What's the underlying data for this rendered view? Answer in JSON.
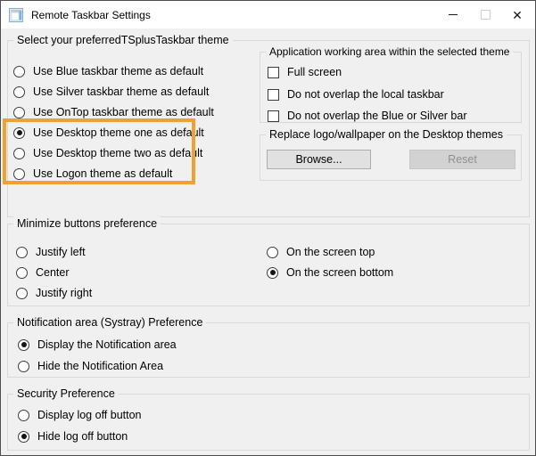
{
  "window": {
    "title": "Remote Taskbar Settings",
    "close_glyph": "✕"
  },
  "theme_group": {
    "label": "Select your preferredTSplusTaskbar theme",
    "options": [
      {
        "label": "Use Blue taskbar theme as default",
        "selected": false,
        "highlighted": false
      },
      {
        "label": "Use Silver taskbar theme as default",
        "selected": false,
        "highlighted": false
      },
      {
        "label": "Use OnTop taskbar theme as default",
        "selected": false,
        "highlighted": false
      },
      {
        "label": "Use Desktop theme one as default",
        "selected": true,
        "highlighted": true
      },
      {
        "label": "Use Desktop theme two as default",
        "selected": false,
        "highlighted": true
      },
      {
        "label": "Use Logon theme as default",
        "selected": false,
        "highlighted": true
      }
    ]
  },
  "working_area_group": {
    "label": "Application working area within the selected theme",
    "options": [
      {
        "label": "Full screen",
        "checked": false
      },
      {
        "label": "Do not overlap the local taskbar",
        "checked": false
      },
      {
        "label": "Do not overlap the Blue or Silver bar",
        "checked": false
      }
    ]
  },
  "replace_group": {
    "label": "Replace logo/wallpaper on the Desktop themes",
    "browse_label": "Browse...",
    "reset_label": "Reset",
    "reset_enabled": false
  },
  "minimize_group": {
    "label": "Minimize buttons preference",
    "left_options": [
      {
        "label": "Justify left",
        "selected": false
      },
      {
        "label": "Center",
        "selected": false
      },
      {
        "label": "Justify right",
        "selected": false
      }
    ],
    "right_options": [
      {
        "label": "On the screen top",
        "selected": false
      },
      {
        "label": "On the screen bottom",
        "selected": true
      }
    ]
  },
  "notification_group": {
    "label": "Notification area (Systray) Preference",
    "options": [
      {
        "label": "Display the Notification area",
        "selected": true
      },
      {
        "label": "Hide the Notification Area",
        "selected": false
      }
    ]
  },
  "security_group": {
    "label": "Security Preference",
    "options": [
      {
        "label": "Display log off button",
        "selected": false
      },
      {
        "label": "Hide log off button",
        "selected": true
      }
    ]
  },
  "colors": {
    "highlight_border": "#EFA133",
    "titlebar_bg": "#FFFFFF",
    "dialog_bg": "#F0F0F0",
    "disabled_button_text": "#8F8F8F"
  }
}
